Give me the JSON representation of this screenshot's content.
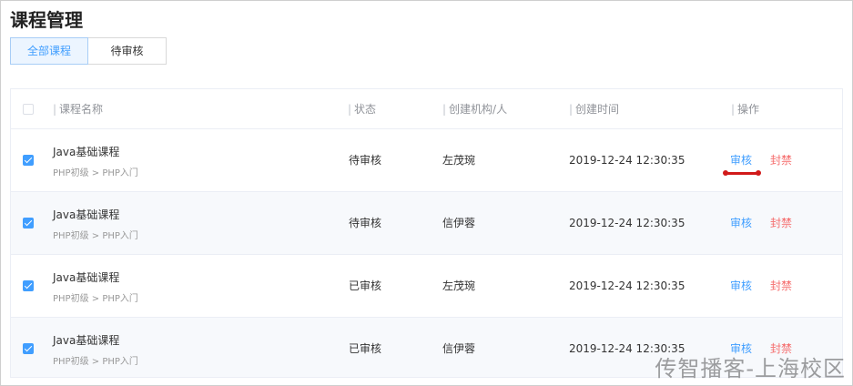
{
  "page": {
    "title": "课程管理",
    "watermark": "传智播客-上海校区"
  },
  "tabs": [
    {
      "label": "全部课程",
      "active": true
    },
    {
      "label": "待审核",
      "active": false
    }
  ],
  "table": {
    "columns": {
      "name": "课程名称",
      "status": "状态",
      "creator": "创建机构/人",
      "created_at": "创建时间",
      "actions": "操作"
    },
    "rows": [
      {
        "checked": true,
        "name": "Java基础课程",
        "path": "PHP初级 > PHP入门",
        "status": "待审核",
        "creator": "左茂琬",
        "created_at": "2019-12-24 12:30:35",
        "audit": "审核",
        "ban": "封禁"
      },
      {
        "checked": true,
        "name": "Java基础课程",
        "path": "PHP初级 > PHP入门",
        "status": "待审核",
        "creator": "信伊蓉",
        "created_at": "2019-12-24 12:30:35",
        "audit": "审核",
        "ban": "封禁"
      },
      {
        "checked": true,
        "name": "Java基础课程",
        "path": "PHP初级 > PHP入门",
        "status": "已审核",
        "creator": "左茂琬",
        "created_at": "2019-12-24 12:30:35",
        "audit": "审核",
        "ban": "封禁"
      },
      {
        "checked": true,
        "name": "Java基础课程",
        "path": "PHP初级 > PHP入门",
        "status": "已审核",
        "creator": "信伊蓉",
        "created_at": "2019-12-24 12:30:35",
        "audit": "审核",
        "ban": "封禁"
      }
    ]
  },
  "colors": {
    "primary": "#409eff",
    "danger": "#f56c6c",
    "annotation": "#d11a1a"
  }
}
